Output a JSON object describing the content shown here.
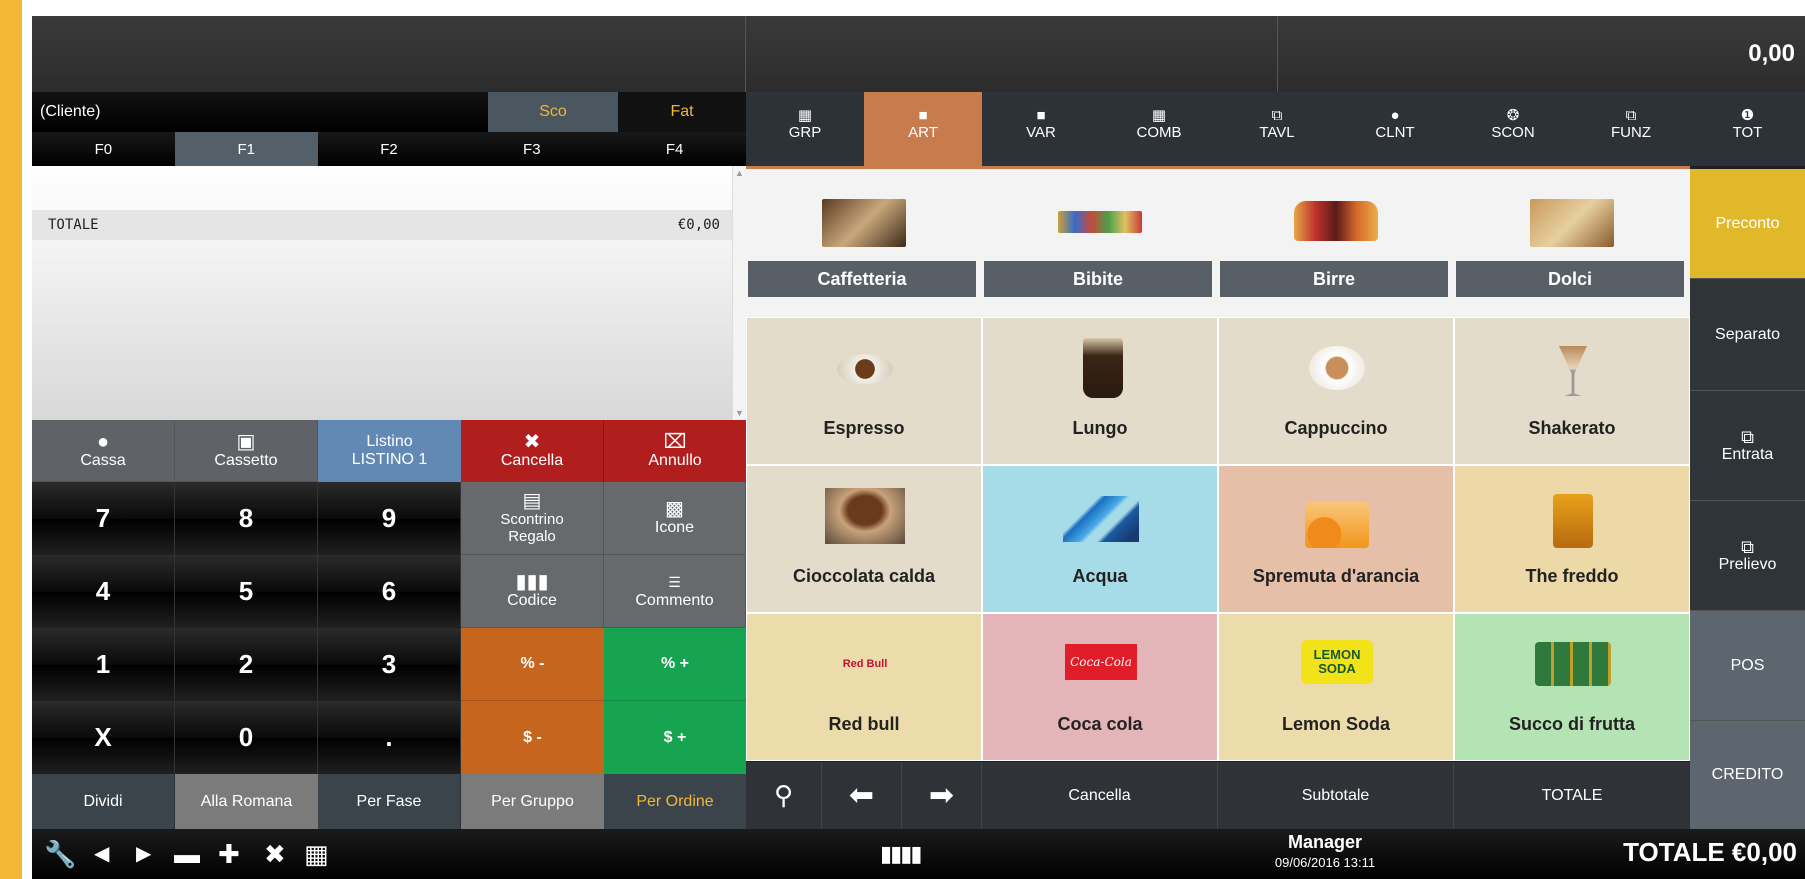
{
  "display": {
    "total": "0,00"
  },
  "client": {
    "label": "(Cliente)",
    "sco": "Sco",
    "fat": "Fat"
  },
  "ftabs": [
    "F0",
    "F1",
    "F2",
    "F3",
    "F4"
  ],
  "receipt": {
    "total_label": "TOTALE",
    "total_value": "€0,00"
  },
  "keys": {
    "cassa": "Cassa",
    "cassetto": "Cassetto",
    "listino_1": "Listino",
    "listino_2": "LISTINO 1",
    "cancella": "Cancella",
    "annullo": "Annullo",
    "scontrino_1": "Scontrino",
    "scontrino_2": "Regalo",
    "icone": "Icone",
    "codice": "Codice",
    "commento": "Commento",
    "n7": "7",
    "n8": "8",
    "n9": "9",
    "n4": "4",
    "n5": "5",
    "n6": "6",
    "n1": "1",
    "n2": "2",
    "n3": "3",
    "nx": "X",
    "n0": "0",
    "ndot": ".",
    "perc_minus": "% -",
    "perc_plus": "% +",
    "dollar_minus": "$ -",
    "dollar_plus": "$ +",
    "dividi": "Dividi",
    "alla_romana": "Alla Romana",
    "per_fase": "Per Fase",
    "per_gruppo": "Per Gruppo",
    "per_ordine": "Per Ordine"
  },
  "cattabs": [
    "GRP",
    "ART",
    "VAR",
    "COMB",
    "TAVL",
    "CLNT",
    "SCON",
    "FUNZ",
    "TOT"
  ],
  "groups": [
    "Caffetteria",
    "Bibite",
    "Birre",
    "Dolci"
  ],
  "tiles": [
    "Espresso",
    "Lungo",
    "Cappuccino",
    "Shakerato",
    "Cioccolata calda",
    "Acqua",
    "Spremuta d'arancia",
    "The freddo",
    "Red bull",
    "Coca cola",
    "Lemon Soda",
    "Succo di frutta"
  ],
  "logos": {
    "redbull": "Red Bull",
    "cocacola": "Coca-Cola",
    "lemon_1": "LEMON",
    "lemon_2": "SODA"
  },
  "navbar": {
    "cancella": "Cancella",
    "subtotale": "Subtotale",
    "totale": "TOTALE"
  },
  "side": {
    "preconto": "Preconto",
    "separato": "Separato",
    "entrata": "Entrata",
    "prelievo": "Prelievo",
    "pos": "POS",
    "credito": "CREDITO"
  },
  "status": {
    "manager": "Manager",
    "datetime": "09/06/2016  13:11",
    "total": "TOTALE €0,00"
  },
  "colors": {
    "accent_orange": "#c87c4e",
    "yellow": "#e0b82a",
    "red": "#b01e1e",
    "green": "#17a450",
    "blue": "#6289b4"
  }
}
